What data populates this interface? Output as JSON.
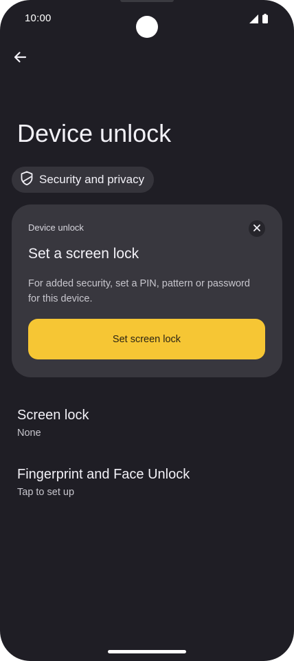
{
  "status": {
    "time": "10:00"
  },
  "page": {
    "title": "Device unlock"
  },
  "chip": {
    "label": "Security and privacy"
  },
  "card": {
    "eyebrow": "Device unlock",
    "title": "Set a screen lock",
    "description": "For added security, set a PIN, pattern or password for this device.",
    "button_label": "Set screen lock"
  },
  "preferences": [
    {
      "title": "Screen lock",
      "subtitle": "None"
    },
    {
      "title": "Fingerprint and Face Unlock",
      "subtitle": "Tap to set up"
    }
  ],
  "colors": {
    "background": "#1f1e25",
    "card": "#38373e",
    "accent": "#f6c634"
  },
  "icons": [
    "back-arrow-icon",
    "shield-icon",
    "close-icon",
    "signal-icon",
    "battery-icon"
  ]
}
